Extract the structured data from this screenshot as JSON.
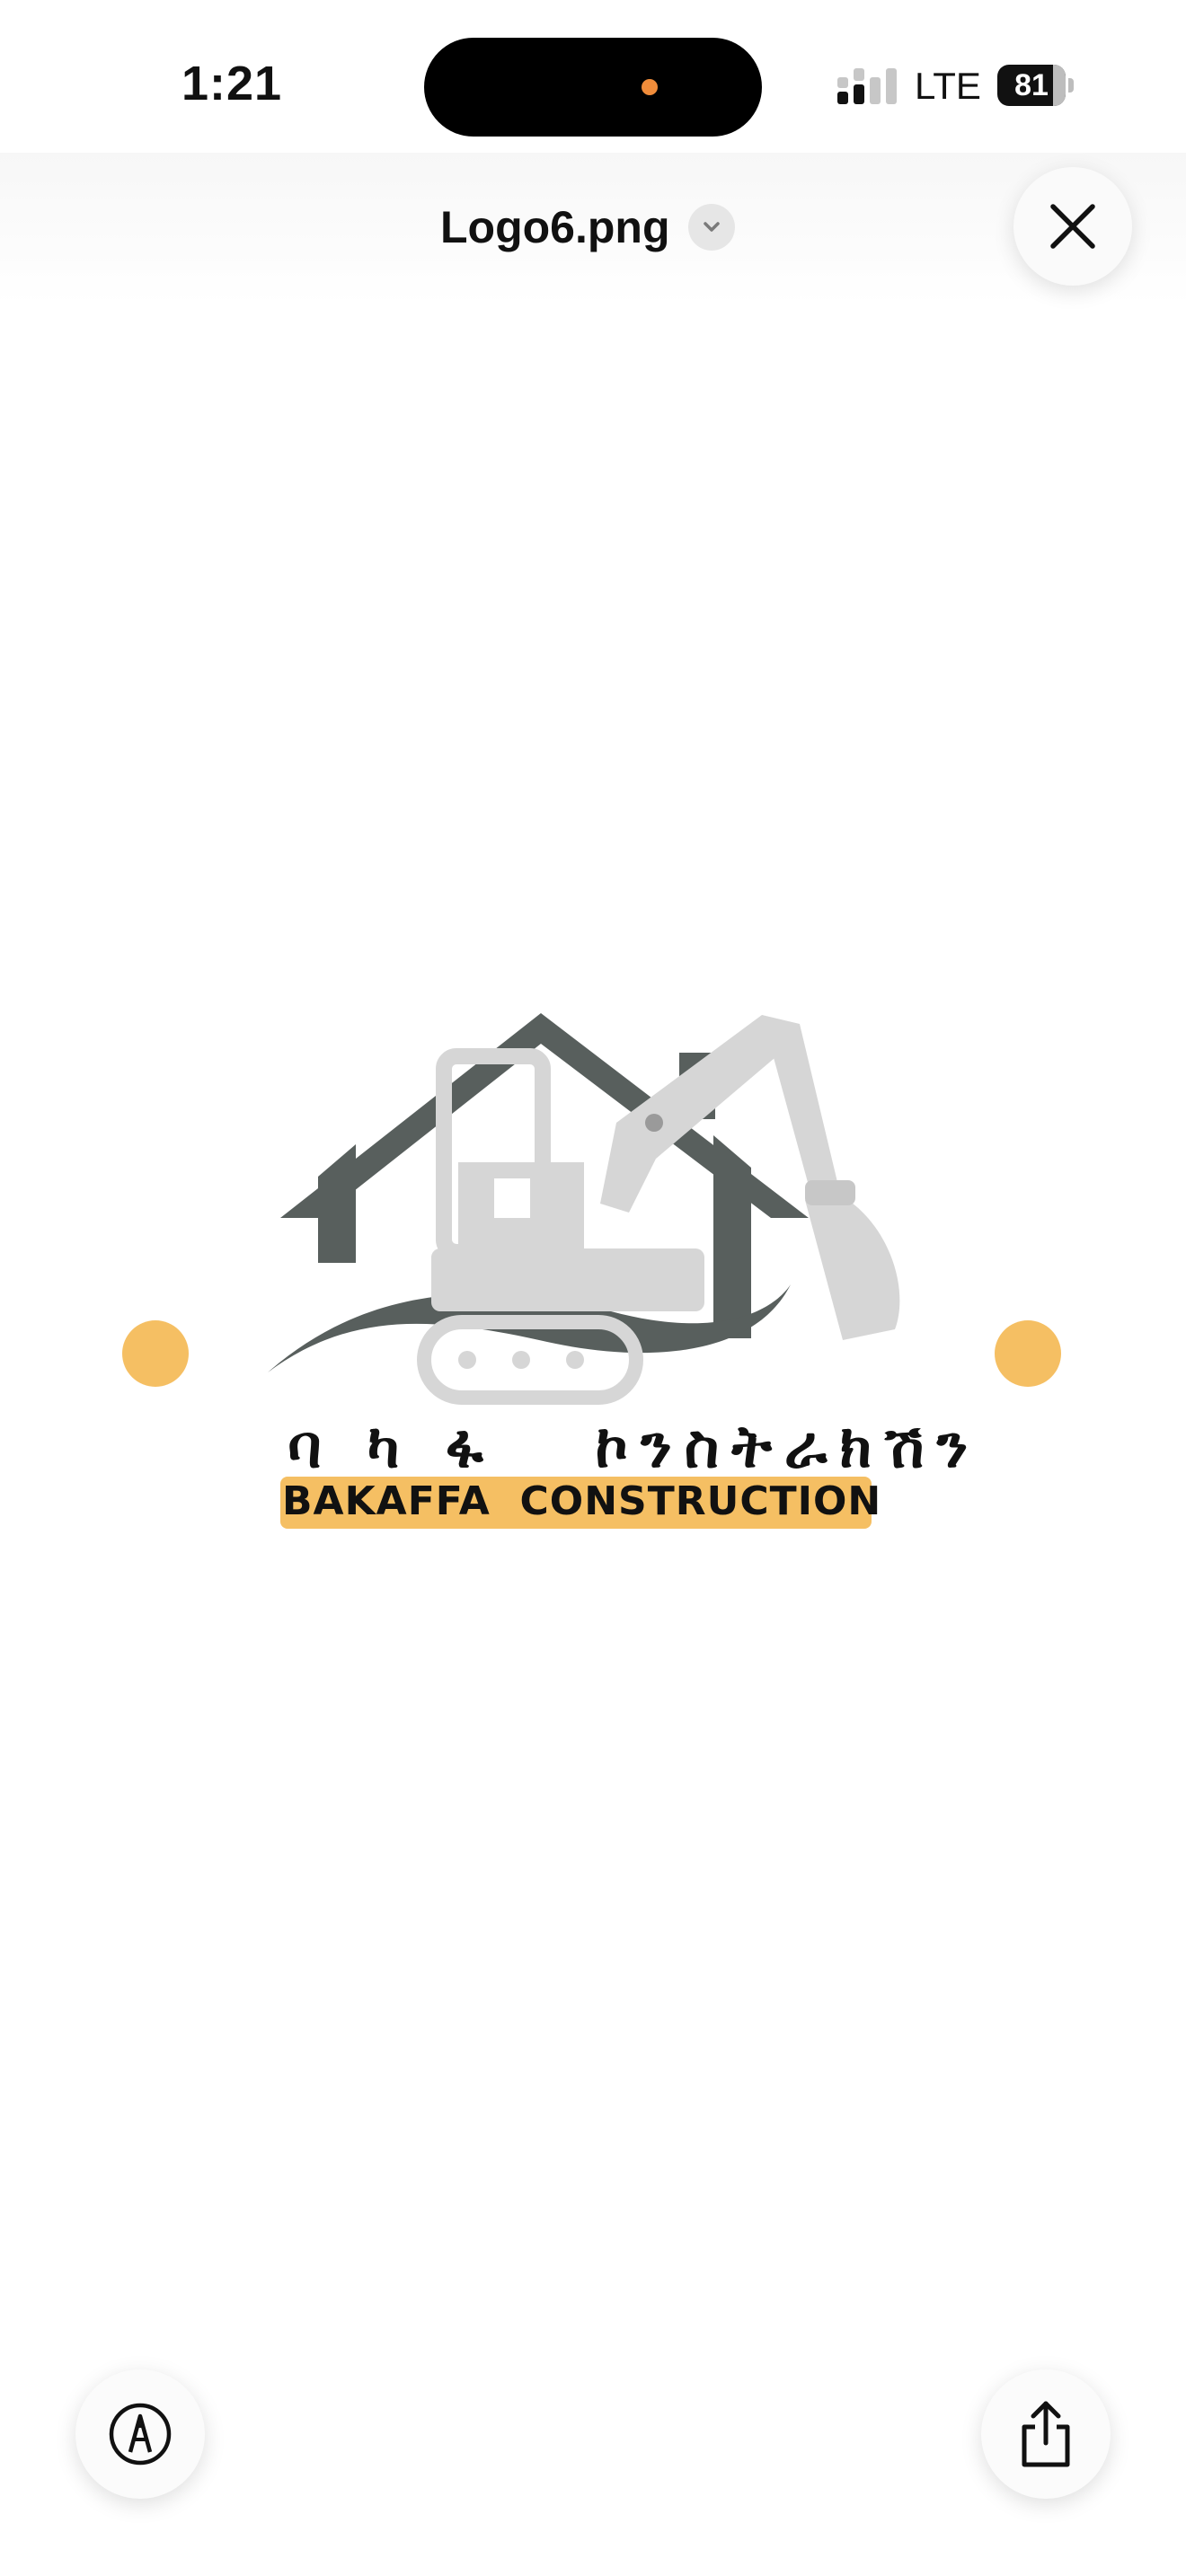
{
  "status_bar": {
    "time": "1:21",
    "network": "LTE",
    "battery_level": "81"
  },
  "header": {
    "file_title": "Logo6.png"
  },
  "logo": {
    "amharic_text": "ባ ካ ፋ   ኮንስትራክሽን",
    "english_text": "BAKAFFA  CONSTRUCTION",
    "colors": {
      "dark_gray": "#585f5d",
      "light_gray": "#d6d6d6",
      "accent_orange": "#f5bf63"
    }
  },
  "icons": {
    "close": "close-icon",
    "chevron": "chevron-down-icon",
    "markup": "markup-pen-icon",
    "share": "share-icon"
  }
}
